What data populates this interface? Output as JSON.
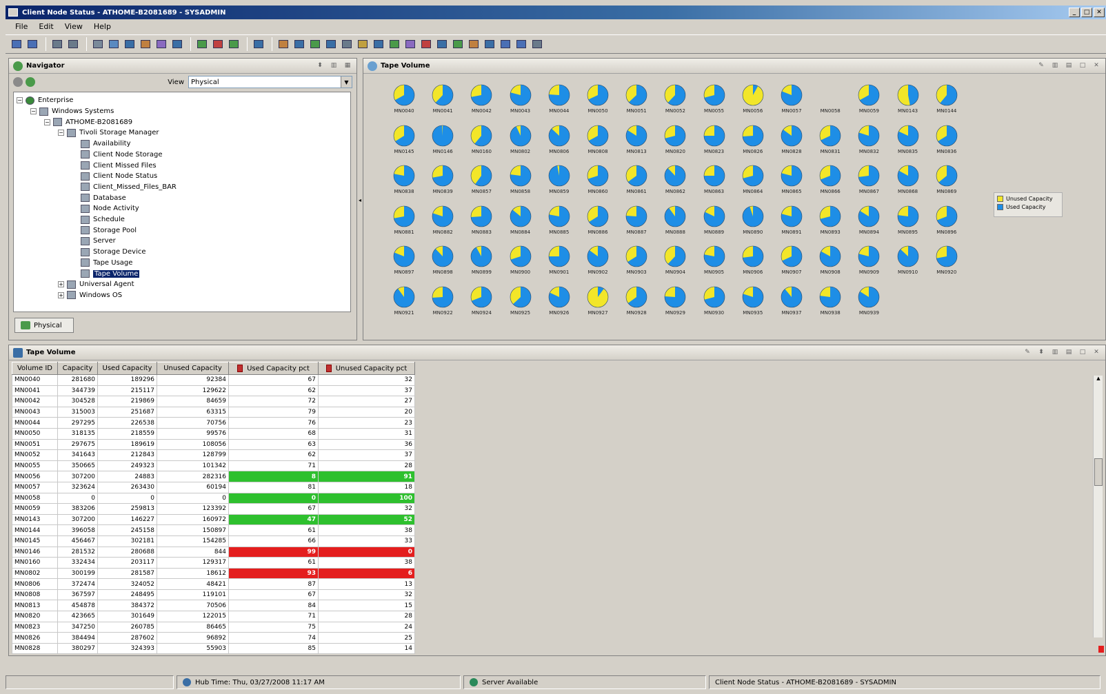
{
  "window": {
    "title": "Client Node Status - ATHOME-B2081689 - SYSADMIN"
  },
  "menu": [
    "File",
    "Edit",
    "View",
    "Help"
  ],
  "navigator": {
    "title": "Navigator",
    "view_label": "View",
    "view_value": "Physical",
    "tab_label": "Physical",
    "tree": [
      {
        "label": "Enterprise",
        "level": 0,
        "toggle": "-",
        "icon": "globe"
      },
      {
        "label": "Windows Systems",
        "level": 1,
        "toggle": "-",
        "icon": "folder"
      },
      {
        "label": "ATHOME-B2081689",
        "level": 2,
        "toggle": "-",
        "icon": "computer"
      },
      {
        "label": "Tivoli Storage Manager",
        "level": 3,
        "toggle": "-",
        "icon": "folder"
      },
      {
        "label": "Availability",
        "level": 4,
        "toggle": "",
        "icon": "workspace"
      },
      {
        "label": "Client Node Storage",
        "level": 4,
        "toggle": "",
        "icon": "workspace"
      },
      {
        "label": "Client Missed Files",
        "level": 4,
        "toggle": "",
        "icon": "workspace"
      },
      {
        "label": "Client Node Status",
        "level": 4,
        "toggle": "",
        "icon": "workspace"
      },
      {
        "label": "Client_Missed_Files_BAR",
        "level": 4,
        "toggle": "",
        "icon": "workspace"
      },
      {
        "label": "Database",
        "level": 4,
        "toggle": "",
        "icon": "workspace"
      },
      {
        "label": "Node Activity",
        "level": 4,
        "toggle": "",
        "icon": "workspace"
      },
      {
        "label": "Schedule",
        "level": 4,
        "toggle": "",
        "icon": "workspace"
      },
      {
        "label": "Storage Pool",
        "level": 4,
        "toggle": "",
        "icon": "workspace"
      },
      {
        "label": "Server",
        "level": 4,
        "toggle": "",
        "icon": "workspace"
      },
      {
        "label": "Storage Device",
        "level": 4,
        "toggle": "",
        "icon": "workspace"
      },
      {
        "label": "Tape Usage",
        "level": 4,
        "toggle": "",
        "icon": "workspace"
      },
      {
        "label": "Tape Volume",
        "level": 4,
        "toggle": "",
        "icon": "workspace",
        "selected": true
      },
      {
        "label": "Universal Agent",
        "level": 3,
        "toggle": "+",
        "icon": "folder"
      },
      {
        "label": "Windows OS",
        "level": 3,
        "toggle": "+",
        "icon": "folder"
      }
    ]
  },
  "chart_panel": {
    "title": "Tape Volume"
  },
  "chart_data": {
    "type": "pie",
    "legend_position": "right",
    "colors": {
      "used": "#1e8ee6",
      "unused": "#f2e629"
    },
    "legend": [
      "Unused Capacity",
      "Used Capacity"
    ],
    "pies": [
      {
        "label": "MN0040",
        "used_pct": 67
      },
      {
        "label": "MN0041",
        "used_pct": 62
      },
      {
        "label": "MN0042",
        "used_pct": 72
      },
      {
        "label": "MN0043",
        "used_pct": 79
      },
      {
        "label": "MN0044",
        "used_pct": 76
      },
      {
        "label": "MN0050",
        "used_pct": 68
      },
      {
        "label": "MN0051",
        "used_pct": 63
      },
      {
        "label": "MN0052",
        "used_pct": 62
      },
      {
        "label": "MN0055",
        "used_pct": 71
      },
      {
        "label": "MN0056",
        "used_pct": 8
      },
      {
        "label": "MN0057",
        "used_pct": 81
      },
      {
        "label": "MN0058",
        "used_pct": 0
      },
      {
        "label": "MN0059",
        "used_pct": 67
      },
      {
        "label": "MN0143",
        "used_pct": 47
      },
      {
        "label": "MN0144",
        "used_pct": 61
      },
      {
        "label": "MN0145",
        "used_pct": 66
      },
      {
        "label": "MN0146",
        "used_pct": 99
      },
      {
        "label": "MN0160",
        "used_pct": 61
      },
      {
        "label": "MN0802",
        "used_pct": 93
      },
      {
        "label": "MN0806",
        "used_pct": 87
      },
      {
        "label": "MN0808",
        "used_pct": 67
      },
      {
        "label": "MN0813",
        "used_pct": 84
      },
      {
        "label": "MN0820",
        "used_pct": 71
      },
      {
        "label": "MN0823",
        "used_pct": 75
      },
      {
        "label": "MN0826",
        "used_pct": 74
      },
      {
        "label": "MN0828",
        "used_pct": 85
      },
      {
        "label": "MN0831",
        "used_pct": 68
      },
      {
        "label": "MN0832",
        "used_pct": 80
      },
      {
        "label": "MN0835",
        "used_pct": 82
      },
      {
        "label": "MN0836",
        "used_pct": 66
      },
      {
        "label": "MN0838",
        "used_pct": 78
      },
      {
        "label": "MN0839",
        "used_pct": 72
      },
      {
        "label": "MN0857",
        "used_pct": 60
      },
      {
        "label": "MN0858",
        "used_pct": 77
      },
      {
        "label": "MN0859",
        "used_pct": 97
      },
      {
        "label": "MN0860",
        "used_pct": 70
      },
      {
        "label": "MN0861",
        "used_pct": 65
      },
      {
        "label": "MN0862",
        "used_pct": 88
      },
      {
        "label": "MN0863",
        "used_pct": 75
      },
      {
        "label": "MN0864",
        "used_pct": 71
      },
      {
        "label": "MN0865",
        "used_pct": 79
      },
      {
        "label": "MN0866",
        "used_pct": 69
      },
      {
        "label": "MN0867",
        "used_pct": 73
      },
      {
        "label": "MN0868",
        "used_pct": 83
      },
      {
        "label": "MN0869",
        "used_pct": 64
      },
      {
        "label": "MN0881",
        "used_pct": 72
      },
      {
        "label": "MN0882",
        "used_pct": 80
      },
      {
        "label": "MN0883",
        "used_pct": 74
      },
      {
        "label": "MN0884",
        "used_pct": 86
      },
      {
        "label": "MN0885",
        "used_pct": 78
      },
      {
        "label": "MN0886",
        "used_pct": 66
      },
      {
        "label": "MN0887",
        "used_pct": 76
      },
      {
        "label": "MN0888",
        "used_pct": 90
      },
      {
        "label": "MN0889",
        "used_pct": 82
      },
      {
        "label": "MN0890",
        "used_pct": 95
      },
      {
        "label": "MN0891",
        "used_pct": 79
      },
      {
        "label": "MN0893",
        "used_pct": 71
      },
      {
        "label": "MN0894",
        "used_pct": 84
      },
      {
        "label": "MN0895",
        "used_pct": 77
      },
      {
        "label": "MN0896",
        "used_pct": 69
      },
      {
        "label": "MN0897",
        "used_pct": 81
      },
      {
        "label": "MN0898",
        "used_pct": 88
      },
      {
        "label": "MN0899",
        "used_pct": 92
      },
      {
        "label": "MN0900",
        "used_pct": 70
      },
      {
        "label": "MN0901",
        "used_pct": 75
      },
      {
        "label": "MN0902",
        "used_pct": 85
      },
      {
        "label": "MN0903",
        "used_pct": 66
      },
      {
        "label": "MN0904",
        "used_pct": 62
      },
      {
        "label": "MN0905",
        "used_pct": 78
      },
      {
        "label": "MN0906",
        "used_pct": 73
      },
      {
        "label": "MN0907",
        "used_pct": 68
      },
      {
        "label": "MN0908",
        "used_pct": 83
      },
      {
        "label": "MN0909",
        "used_pct": 79
      },
      {
        "label": "MN0910",
        "used_pct": 87
      },
      {
        "label": "MN0920",
        "used_pct": 72
      },
      {
        "label": "MN0921",
        "used_pct": 90
      },
      {
        "label": "MN0922",
        "used_pct": 74
      },
      {
        "label": "MN0924",
        "used_pct": 69
      },
      {
        "label": "MN0925",
        "used_pct": 63
      },
      {
        "label": "MN0926",
        "used_pct": 82
      },
      {
        "label": "MN0927",
        "used_pct": 10
      },
      {
        "label": "MN0928",
        "used_pct": 65
      },
      {
        "label": "MN0929",
        "used_pct": 76
      },
      {
        "label": "MN0930",
        "used_pct": 71
      },
      {
        "label": "MN0935",
        "used_pct": 80
      },
      {
        "label": "MN0937",
        "used_pct": 89
      },
      {
        "label": "MN0938",
        "used_pct": 77
      },
      {
        "label": "MN0939",
        "used_pct": 84
      }
    ]
  },
  "table_panel": {
    "title": "Tape Volume",
    "columns": [
      "Volume ID",
      "Capacity",
      "Used Capacity",
      "Unused Capacity",
      "Used Capacity pct",
      "Unused Capacity pct"
    ],
    "rows": [
      [
        "MN0040",
        "281680",
        "189296",
        "92384",
        "67",
        "32",
        ""
      ],
      [
        "MN0041",
        "344739",
        "215117",
        "129622",
        "62",
        "37",
        ""
      ],
      [
        "MN0042",
        "304528",
        "219869",
        "84659",
        "72",
        "27",
        ""
      ],
      [
        "MN0043",
        "315003",
        "251687",
        "63315",
        "79",
        "20",
        ""
      ],
      [
        "MN0044",
        "297295",
        "226538",
        "70756",
        "76",
        "23",
        ""
      ],
      [
        "MN0050",
        "318135",
        "218559",
        "99576",
        "68",
        "31",
        ""
      ],
      [
        "MN0051",
        "297675",
        "189619",
        "108056",
        "63",
        "36",
        ""
      ],
      [
        "MN0052",
        "341643",
        "212843",
        "128799",
        "62",
        "37",
        ""
      ],
      [
        "MN0055",
        "350665",
        "249323",
        "101342",
        "71",
        "28",
        ""
      ],
      [
        "MN0056",
        "307200",
        "24883",
        "282316",
        "8",
        "91",
        "green"
      ],
      [
        "MN0057",
        "323624",
        "263430",
        "60194",
        "81",
        "18",
        ""
      ],
      [
        "MN0058",
        "0",
        "0",
        "0",
        "0",
        "100",
        "green"
      ],
      [
        "MN0059",
        "383206",
        "259813",
        "123392",
        "67",
        "32",
        ""
      ],
      [
        "MN0143",
        "307200",
        "146227",
        "160972",
        "47",
        "52",
        "green"
      ],
      [
        "MN0144",
        "396058",
        "245158",
        "150897",
        "61",
        "38",
        ""
      ],
      [
        "MN0145",
        "456467",
        "302181",
        "154285",
        "66",
        "33",
        ""
      ],
      [
        "MN0146",
        "281532",
        "280688",
        "844",
        "99",
        "0",
        "red"
      ],
      [
        "MN0160",
        "332434",
        "203117",
        "129317",
        "61",
        "38",
        ""
      ],
      [
        "MN0802",
        "300199",
        "281587",
        "18612",
        "93",
        "6",
        "red"
      ],
      [
        "MN0806",
        "372474",
        "324052",
        "48421",
        "87",
        "13",
        ""
      ],
      [
        "MN0808",
        "367597",
        "248495",
        "119101",
        "67",
        "32",
        ""
      ],
      [
        "MN0813",
        "454878",
        "384372",
        "70506",
        "84",
        "15",
        ""
      ],
      [
        "MN0820",
        "423665",
        "301649",
        "122015",
        "71",
        "28",
        ""
      ],
      [
        "MN0823",
        "347250",
        "260785",
        "86465",
        "75",
        "24",
        ""
      ],
      [
        "MN0826",
        "384494",
        "287602",
        "96892",
        "74",
        "25",
        ""
      ],
      [
        "MN0828",
        "380297",
        "324393",
        "55903",
        "85",
        "14",
        ""
      ]
    ]
  },
  "status": {
    "hub_time": "Hub Time: Thu, 03/27/2008 11:17 AM",
    "server": "Server Available",
    "workspace": "Client Node Status - ATHOME-B2081689 - SYSADMIN"
  }
}
